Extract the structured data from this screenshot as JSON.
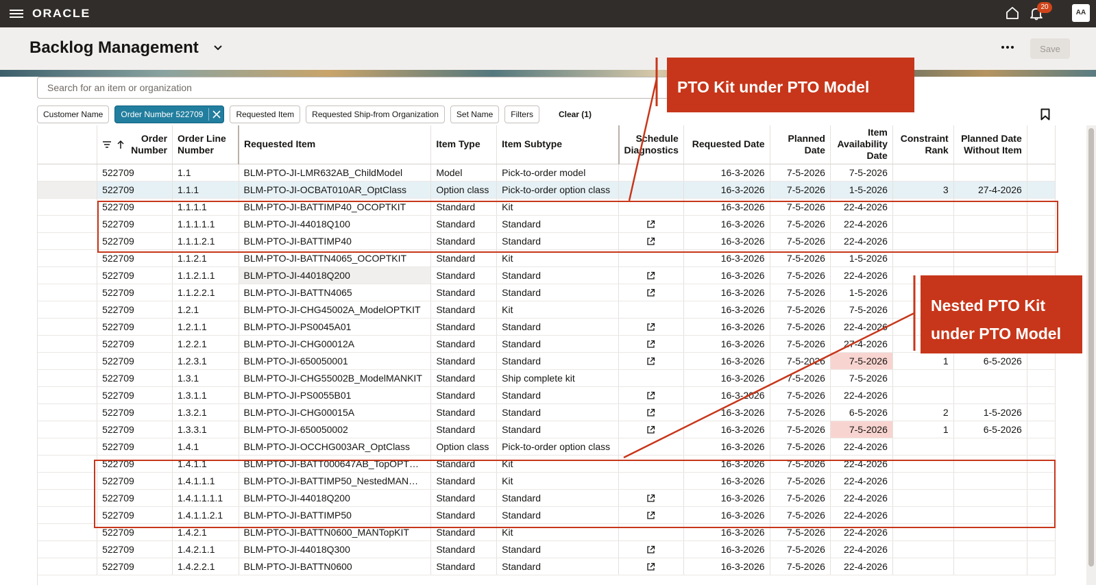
{
  "topbar": {
    "logo": "ORACLE",
    "notification_count": "20",
    "avatar_initials": "AA"
  },
  "header": {
    "title": "Backlog Management",
    "save_label": "Save"
  },
  "search": {
    "placeholder": "Search for an item or organization"
  },
  "filters": {
    "chips": [
      "Customer Name",
      "Order Number 522709",
      "Requested Item",
      "Requested Ship-from Organization",
      "Set Name",
      "Filters"
    ],
    "clear_label": "Clear (1)"
  },
  "table": {
    "columns": {
      "order_number": "Order Number",
      "order_line_number": "Order Line Number",
      "requested_item": "Requested Item",
      "item_type": "Item Type",
      "item_subtype": "Item Subtype",
      "schedule_diagnostics": "Schedule Diagnostics",
      "requested_date": "Requested Date",
      "planned_date": "Planned Date",
      "item_availability_date": "Item Availability Date",
      "constraint_rank": "Constraint Rank",
      "planned_date_without_item": "Planned Date Without Item"
    },
    "rows": [
      {
        "order": "522709",
        "line": "1.1",
        "item": "BLM-PTO-JI-LMR632AB_ChildModel",
        "type": "Model",
        "subtype": "Pick-to-order model",
        "diag": false,
        "req": "16-3-2026",
        "planned": "7-5-2026",
        "avail": "7-5-2026",
        "rank": "",
        "pdwi": ""
      },
      {
        "order": "522709",
        "line": "1.1.1",
        "item": "BLM-PTO-JI-OCBAT010AR_OptClass",
        "type": "Option class",
        "subtype": "Pick-to-order option class",
        "diag": false,
        "req": "16-3-2026",
        "planned": "7-5-2026",
        "avail": "1-5-2026",
        "rank": "3",
        "pdwi": "27-4-2026"
      },
      {
        "order": "522709",
        "line": "1.1.1.1",
        "item": "BLM-PTO-JI-BATTIMP40_OCOPTKIT",
        "type": "Standard",
        "subtype": "Kit",
        "diag": false,
        "req": "16-3-2026",
        "planned": "7-5-2026",
        "avail": "22-4-2026",
        "rank": "",
        "pdwi": ""
      },
      {
        "order": "522709",
        "line": "1.1.1.1.1",
        "item": "BLM-PTO-JI-44018Q100",
        "type": "Standard",
        "subtype": "Standard",
        "diag": true,
        "req": "16-3-2026",
        "planned": "7-5-2026",
        "avail": "22-4-2026",
        "rank": "",
        "pdwi": ""
      },
      {
        "order": "522709",
        "line": "1.1.1.2.1",
        "item": "BLM-PTO-JI-BATTIMP40",
        "type": "Standard",
        "subtype": "Standard",
        "diag": true,
        "req": "16-3-2026",
        "planned": "7-5-2026",
        "avail": "22-4-2026",
        "rank": "",
        "pdwi": ""
      },
      {
        "order": "522709",
        "line": "1.1.2.1",
        "item": "BLM-PTO-JI-BATTN4065_OCOPTKIT",
        "type": "Standard",
        "subtype": "Kit",
        "diag": false,
        "req": "16-3-2026",
        "planned": "7-5-2026",
        "avail": "1-5-2026",
        "rank": "",
        "pdwi": ""
      },
      {
        "order": "522709",
        "line": "1.1.2.1.1",
        "item": "BLM-PTO-JI-44018Q200",
        "type": "Standard",
        "subtype": "Standard",
        "diag": true,
        "req": "16-3-2026",
        "planned": "7-5-2026",
        "avail": "22-4-2026",
        "rank": "",
        "pdwi": ""
      },
      {
        "order": "522709",
        "line": "1.1.2.2.1",
        "item": "BLM-PTO-JI-BATTN4065",
        "type": "Standard",
        "subtype": "Standard",
        "diag": true,
        "req": "16-3-2026",
        "planned": "7-5-2026",
        "avail": "1-5-2026",
        "rank": "",
        "pdwi": ""
      },
      {
        "order": "522709",
        "line": "1.2.1",
        "item": "BLM-PTO-JI-CHG45002A_ModelOPTKIT",
        "type": "Standard",
        "subtype": "Kit",
        "diag": false,
        "req": "16-3-2026",
        "planned": "7-5-2026",
        "avail": "7-5-2026",
        "rank": "",
        "pdwi": ""
      },
      {
        "order": "522709",
        "line": "1.2.1.1",
        "item": "BLM-PTO-JI-PS0045A01",
        "type": "Standard",
        "subtype": "Standard",
        "diag": true,
        "req": "16-3-2026",
        "planned": "7-5-2026",
        "avail": "22-4-2026",
        "rank": "",
        "pdwi": ""
      },
      {
        "order": "522709",
        "line": "1.2.2.1",
        "item": "BLM-PTO-JI-CHG00012A",
        "type": "Standard",
        "subtype": "Standard",
        "diag": true,
        "req": "16-3-2026",
        "planned": "7-5-2026",
        "avail": "27-4-2026",
        "rank": "",
        "pdwi": ""
      },
      {
        "order": "522709",
        "line": "1.2.3.1",
        "item": "BLM-PTO-JI-650050001",
        "type": "Standard",
        "subtype": "Standard",
        "diag": true,
        "req": "16-3-2026",
        "planned": "7-5-2026",
        "avail": "7-5-2026",
        "rank": "1",
        "pdwi": "6-5-2026",
        "pink": true
      },
      {
        "order": "522709",
        "line": "1.3.1",
        "item": "BLM-PTO-JI-CHG55002B_ModelMANKIT",
        "type": "Standard",
        "subtype": "Ship complete kit",
        "diag": false,
        "req": "16-3-2026",
        "planned": "7-5-2026",
        "avail": "7-5-2026",
        "rank": "",
        "pdwi": ""
      },
      {
        "order": "522709",
        "line": "1.3.1.1",
        "item": "BLM-PTO-JI-PS0055B01",
        "type": "Standard",
        "subtype": "Standard",
        "diag": true,
        "req": "16-3-2026",
        "planned": "7-5-2026",
        "avail": "22-4-2026",
        "rank": "",
        "pdwi": ""
      },
      {
        "order": "522709",
        "line": "1.3.2.1",
        "item": "BLM-PTO-JI-CHG00015A",
        "type": "Standard",
        "subtype": "Standard",
        "diag": true,
        "req": "16-3-2026",
        "planned": "7-5-2026",
        "avail": "6-5-2026",
        "rank": "2",
        "pdwi": "1-5-2026"
      },
      {
        "order": "522709",
        "line": "1.3.3.1",
        "item": "BLM-PTO-JI-650050002",
        "type": "Standard",
        "subtype": "Standard",
        "diag": true,
        "req": "16-3-2026",
        "planned": "7-5-2026",
        "avail": "7-5-2026",
        "rank": "1",
        "pdwi": "6-5-2026",
        "pink": true
      },
      {
        "order": "522709",
        "line": "1.4.1",
        "item": "BLM-PTO-JI-OCCHG003AR_OptClass",
        "type": "Option class",
        "subtype": "Pick-to-order option class",
        "diag": false,
        "req": "16-3-2026",
        "planned": "7-5-2026",
        "avail": "22-4-2026",
        "rank": "",
        "pdwi": ""
      },
      {
        "order": "522709",
        "line": "1.4.1.1",
        "item": "BLM-PTO-JI-BATT000647AB_TopOPT…",
        "type": "Standard",
        "subtype": "Kit",
        "diag": false,
        "req": "16-3-2026",
        "planned": "7-5-2026",
        "avail": "22-4-2026",
        "rank": "",
        "pdwi": ""
      },
      {
        "order": "522709",
        "line": "1.4.1.1.1",
        "item": "BLM-PTO-JI-BATTIMP50_NestedMAN…",
        "type": "Standard",
        "subtype": "Kit",
        "diag": false,
        "req": "16-3-2026",
        "planned": "7-5-2026",
        "avail": "22-4-2026",
        "rank": "",
        "pdwi": ""
      },
      {
        "order": "522709",
        "line": "1.4.1.1.1.1",
        "item": "BLM-PTO-JI-44018Q200",
        "type": "Standard",
        "subtype": "Standard",
        "diag": true,
        "req": "16-3-2026",
        "planned": "7-5-2026",
        "avail": "22-4-2026",
        "rank": "",
        "pdwi": ""
      },
      {
        "order": "522709",
        "line": "1.4.1.1.2.1",
        "item": "BLM-PTO-JI-BATTIMP50",
        "type": "Standard",
        "subtype": "Standard",
        "diag": true,
        "req": "16-3-2026",
        "planned": "7-5-2026",
        "avail": "22-4-2026",
        "rank": "",
        "pdwi": ""
      },
      {
        "order": "522709",
        "line": "1.4.2.1",
        "item": "BLM-PTO-JI-BATTN0600_MANTopKIT",
        "type": "Standard",
        "subtype": "Kit",
        "diag": false,
        "req": "16-3-2026",
        "planned": "7-5-2026",
        "avail": "22-4-2026",
        "rank": "",
        "pdwi": ""
      },
      {
        "order": "522709",
        "line": "1.4.2.1.1",
        "item": "BLM-PTO-JI-44018Q300",
        "type": "Standard",
        "subtype": "Standard",
        "diag": true,
        "req": "16-3-2026",
        "planned": "7-5-2026",
        "avail": "22-4-2026",
        "rank": "",
        "pdwi": ""
      },
      {
        "order": "522709",
        "line": "1.4.2.2.1",
        "item": "BLM-PTO-JI-BATTN0600",
        "type": "Standard",
        "subtype": "Standard",
        "diag": true,
        "req": "16-3-2026",
        "planned": "7-5-2026",
        "avail": "22-4-2026",
        "rank": "",
        "pdwi": ""
      }
    ]
  },
  "annotations": {
    "callout_1": "PTO Kit under PTO Model",
    "callout_2_line1": "Nested PTO Kit",
    "callout_2_line2": "under PTO Model"
  },
  "colors": {
    "topbar": "#312d2a",
    "accent_chip": "#227e9e",
    "callout": "#c7361a",
    "selected_row": "#e6f1f6",
    "constraint_cell": "#f8d4d0"
  }
}
